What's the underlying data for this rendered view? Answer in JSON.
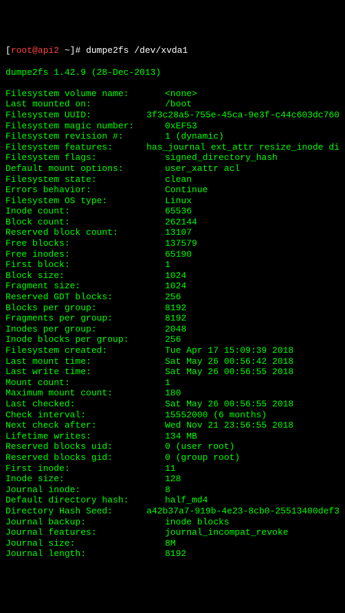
{
  "prompt": {
    "bracket_open": "[",
    "user_host": "root@api2",
    "tilde": " ~",
    "bracket_close": "]",
    "hash": "# ",
    "command": "dumpe2fs /dev/xvda1"
  },
  "version_line": "dumpe2fs 1.42.9 (28-Dec-2013)",
  "rows": [
    {
      "label": "Filesystem volume name:",
      "value": "<none>"
    },
    {
      "label": "Last mounted on:",
      "value": "/boot"
    },
    {
      "label": "Filesystem UUID:",
      "value": "3f3c28a5-755e-45ca-9e3f-c44c603dc760"
    },
    {
      "label": "Filesystem magic number:",
      "value": "0xEF53"
    },
    {
      "label": "Filesystem revision #:",
      "value": "1 (dynamic)"
    },
    {
      "label": "Filesystem features:",
      "value": "has_journal ext_attr resize_inode di"
    },
    {
      "label": "Filesystem flags:",
      "value": "signed_directory_hash"
    },
    {
      "label": "Default mount options:",
      "value": "user_xattr acl"
    },
    {
      "label": "Filesystem state:",
      "value": "clean"
    },
    {
      "label": "Errors behavior:",
      "value": "Continue"
    },
    {
      "label": "Filesystem OS type:",
      "value": "Linux"
    },
    {
      "label": "Inode count:",
      "value": "65536"
    },
    {
      "label": "Block count:",
      "value": "262144"
    },
    {
      "label": "Reserved block count:",
      "value": "13107"
    },
    {
      "label": "Free blocks:",
      "value": "137579"
    },
    {
      "label": "Free inodes:",
      "value": "65190"
    },
    {
      "label": "First block:",
      "value": "1"
    },
    {
      "label": "Block size:",
      "value": "1024"
    },
    {
      "label": "Fragment size:",
      "value": "1024"
    },
    {
      "label": "Reserved GDT blocks:",
      "value": "256"
    },
    {
      "label": "Blocks per group:",
      "value": "8192"
    },
    {
      "label": "Fragments per group:",
      "value": "8192"
    },
    {
      "label": "Inodes per group:",
      "value": "2048"
    },
    {
      "label": "Inode blocks per group:",
      "value": "256"
    },
    {
      "label": "Filesystem created:",
      "value": "Tue Apr 17 15:09:39 2018"
    },
    {
      "label": "Last mount time:",
      "value": "Sat May 26 00:56:42 2018"
    },
    {
      "label": "Last write time:",
      "value": "Sat May 26 00:56:55 2018"
    },
    {
      "label": "Mount count:",
      "value": "1"
    },
    {
      "label": "Maximum mount count:",
      "value": "180"
    },
    {
      "label": "Last checked:",
      "value": "Sat May 26 00:56:55 2018"
    },
    {
      "label": "Check interval:",
      "value": "15552000 (6 months)"
    },
    {
      "label": "Next check after:",
      "value": "Wed Nov 21 23:56:55 2018"
    },
    {
      "label": "Lifetime writes:",
      "value": "134 MB"
    },
    {
      "label": "Reserved blocks uid:",
      "value": "0 (user root)"
    },
    {
      "label": "Reserved blocks gid:",
      "value": "0 (group root)"
    },
    {
      "label": "First inode:",
      "value": "11"
    },
    {
      "label": "Inode size:",
      "value": "128"
    },
    {
      "label": "Journal inode:",
      "value": "8"
    },
    {
      "label": "Default directory hash:",
      "value": "half_md4"
    },
    {
      "label": "Directory Hash Seed:",
      "value": "a42b37a7-919b-4e23-8cb0-25513400def3"
    },
    {
      "label": "Journal backup:",
      "value": "inode blocks"
    },
    {
      "label": "Journal features:",
      "value": "journal_incompat_revoke"
    },
    {
      "label": "Journal size:",
      "value": "8M"
    },
    {
      "label": "Journal length:",
      "value": "8192"
    }
  ]
}
